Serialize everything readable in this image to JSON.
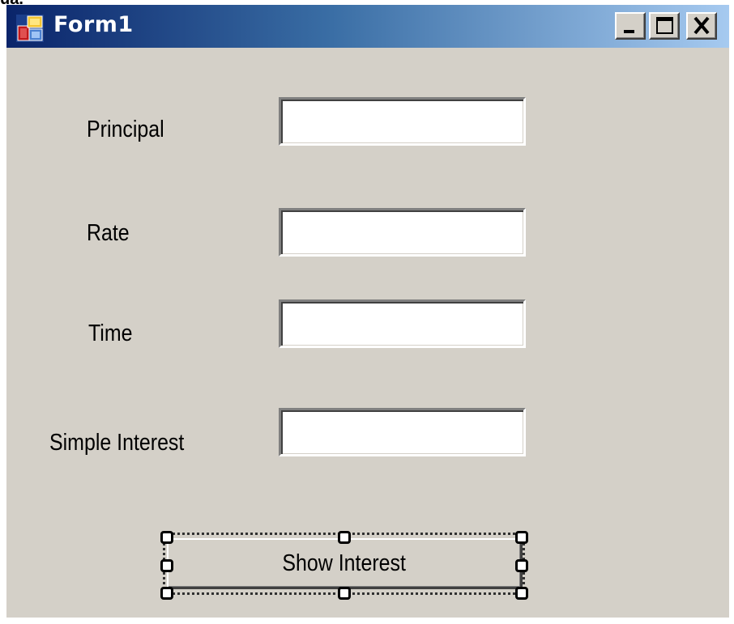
{
  "stray_text": "ua.",
  "window": {
    "title": "Form1",
    "icon": "windows-form-icon",
    "caption_buttons": {
      "minimize": "minimize-icon",
      "maximize": "maximize-icon",
      "close": "close-icon"
    }
  },
  "form": {
    "fields": [
      {
        "label": "Principal",
        "value": ""
      },
      {
        "label": "Rate",
        "value": ""
      },
      {
        "label": "Time",
        "value": ""
      },
      {
        "label": "Simple Interest",
        "value": ""
      }
    ],
    "button_label": "Show Interest"
  },
  "colors": {
    "titlebar_start": "#0a246a",
    "titlebar_end": "#a6caf0",
    "window_background": "#d4d0c8",
    "textbox_background": "#ffffff"
  }
}
